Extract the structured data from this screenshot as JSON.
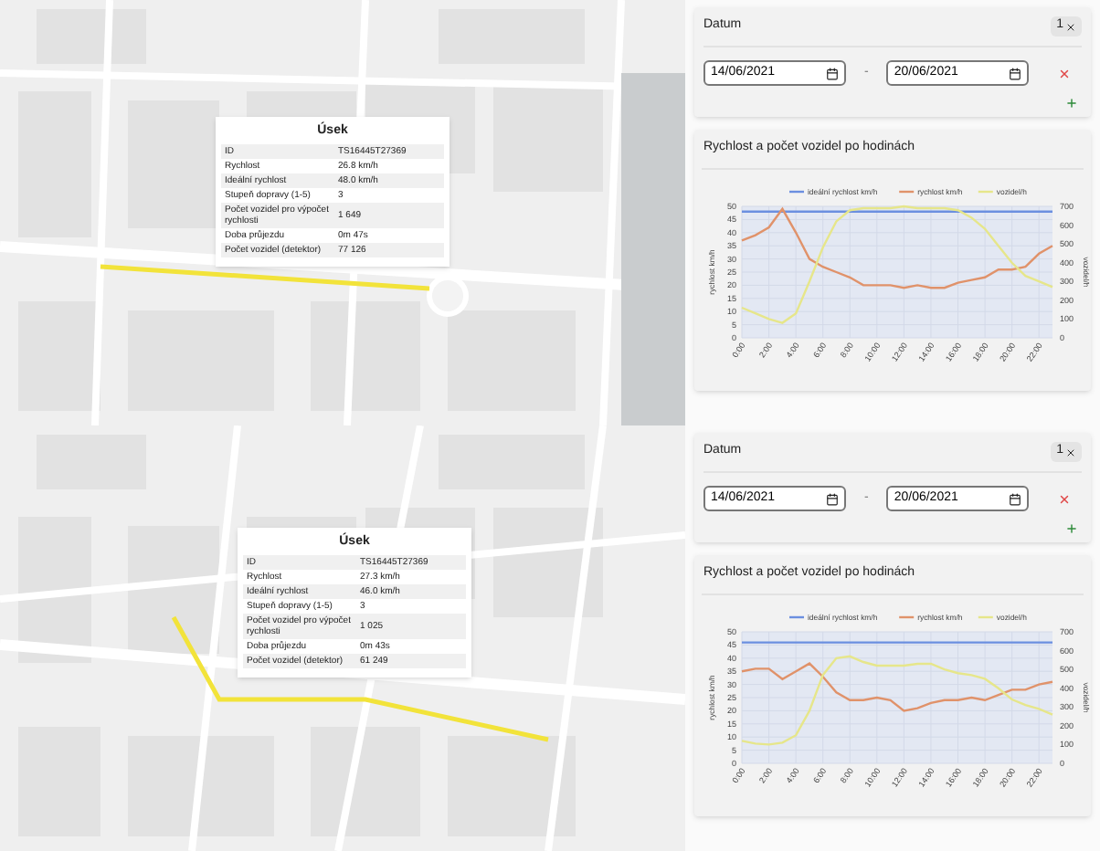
{
  "views": [
    {
      "popup": {
        "title": "Úsek",
        "rows": [
          {
            "label": "ID",
            "value": "TS16445T27369"
          },
          {
            "label": "Rychlost",
            "value": "26.8 km/h"
          },
          {
            "label": "Ideální rychlost",
            "value": "48.0 km/h"
          },
          {
            "label": "Stupeň dopravy (1-5)",
            "value": "3"
          },
          {
            "label": "Počet vozidel pro výpočet rychlosti",
            "value": "1 649"
          },
          {
            "label": "Doba průjezdu",
            "value": "0m 47s"
          },
          {
            "label": "Počet vozidel (detektor)",
            "value": "77 126"
          }
        ]
      },
      "filter": {
        "title": "Datum",
        "badge": "1",
        "from": "14/06/2021",
        "separator": "-",
        "to": "20/06/2021"
      },
      "chart": {
        "title": "Rychlost a počet vozidel po hodinách",
        "chart_data": {
          "type": "line",
          "grid": true,
          "legend": "top",
          "ylabel": "rychlost km/h",
          "y2label": "vozidel/h",
          "x": [
            0,
            1,
            2,
            3,
            4,
            5,
            6,
            7,
            8,
            9,
            10,
            11,
            12,
            13,
            14,
            15,
            16,
            17,
            18,
            19,
            20,
            21,
            22,
            23
          ],
          "xlim": [
            0,
            23
          ],
          "xticks": [
            {
              "value": 0,
              "label": "0:00"
            },
            {
              "value": 2,
              "label": "2:00"
            },
            {
              "value": 4,
              "label": "4:00"
            },
            {
              "value": 6,
              "label": "6:00"
            },
            {
              "value": 8,
              "label": "8:00"
            },
            {
              "value": 10,
              "label": "10:00"
            },
            {
              "value": 12,
              "label": "12:00"
            },
            {
              "value": 14,
              "label": "14:00"
            },
            {
              "value": 16,
              "label": "16:00"
            },
            {
              "value": 18,
              "label": "18:00"
            },
            {
              "value": 20,
              "label": "20:00"
            },
            {
              "value": 22,
              "label": "22:00"
            }
          ],
          "ylim": [
            0,
            50
          ],
          "yticks": [
            0,
            5,
            10,
            15,
            20,
            25,
            30,
            35,
            40,
            45,
            50
          ],
          "y2lim": [
            0,
            700
          ],
          "y2ticks": [
            0,
            100,
            200,
            300,
            400,
            500,
            600,
            700
          ],
          "series": [
            {
              "name": "ideální rychlost km/h",
              "color": "#6b8fe0",
              "values": [
                48,
                48,
                48,
                48,
                48,
                48,
                48,
                48,
                48,
                48,
                48,
                48,
                48,
                48,
                48,
                48,
                48,
                48,
                48,
                48,
                48,
                48,
                48,
                48
              ]
            },
            {
              "name": "rychlost km/h",
              "color": "#e0926a",
              "values": [
                37,
                39,
                42,
                49,
                40,
                30,
                27,
                25,
                23,
                20,
                20,
                20,
                19,
                20,
                19,
                19,
                21,
                22,
                23,
                26,
                26,
                27,
                32,
                35
              ]
            },
            {
              "name": "vozidel/h",
              "color": "#e6e68a",
              "axis": "y2",
              "values": [
                160,
                130,
                100,
                80,
                130,
                300,
                480,
                620,
                680,
                690,
                690,
                690,
                700,
                690,
                690,
                690,
                680,
                640,
                580,
                490,
                400,
                330,
                300,
                270
              ]
            }
          ]
        }
      }
    },
    {
      "popup": {
        "title": "Úsek",
        "rows": [
          {
            "label": "ID",
            "value": "TS16445T27369"
          },
          {
            "label": "Rychlost",
            "value": "27.3 km/h"
          },
          {
            "label": "Ideální rychlost",
            "value": "46.0 km/h"
          },
          {
            "label": "Stupeň dopravy (1-5)",
            "value": "3"
          },
          {
            "label": "Počet vozidel pro výpočet rychlosti",
            "value": "1 025"
          },
          {
            "label": "Doba průjezdu",
            "value": "0m 43s"
          },
          {
            "label": "Počet vozidel (detektor)",
            "value": "61 249"
          }
        ]
      },
      "filter": {
        "title": "Datum",
        "badge": "1",
        "from": "14/06/2021",
        "separator": "-",
        "to": "20/06/2021"
      },
      "chart": {
        "title": "Rychlost a počet vozidel po hodinách",
        "chart_data": {
          "type": "line",
          "grid": true,
          "legend": "top",
          "ylabel": "rychlost km/h",
          "y2label": "vozidel/h",
          "x": [
            0,
            1,
            2,
            3,
            4,
            5,
            6,
            7,
            8,
            9,
            10,
            11,
            12,
            13,
            14,
            15,
            16,
            17,
            18,
            19,
            20,
            21,
            22,
            23
          ],
          "xlim": [
            0,
            23
          ],
          "xticks": [
            {
              "value": 0,
              "label": "0:00"
            },
            {
              "value": 2,
              "label": "2:00"
            },
            {
              "value": 4,
              "label": "4:00"
            },
            {
              "value": 6,
              "label": "6:00"
            },
            {
              "value": 8,
              "label": "8:00"
            },
            {
              "value": 10,
              "label": "10:00"
            },
            {
              "value": 12,
              "label": "12:00"
            },
            {
              "value": 14,
              "label": "14:00"
            },
            {
              "value": 16,
              "label": "16:00"
            },
            {
              "value": 18,
              "label": "18:00"
            },
            {
              "value": 20,
              "label": "20:00"
            },
            {
              "value": 22,
              "label": "22:00"
            }
          ],
          "ylim": [
            0,
            50
          ],
          "yticks": [
            0,
            5,
            10,
            15,
            20,
            25,
            30,
            35,
            40,
            45,
            50
          ],
          "y2lim": [
            0,
            700
          ],
          "y2ticks": [
            0,
            100,
            200,
            300,
            400,
            500,
            600,
            700
          ],
          "series": [
            {
              "name": "ideální rychlost km/h",
              "color": "#6b8fe0",
              "values": [
                46,
                46,
                46,
                46,
                46,
                46,
                46,
                46,
                46,
                46,
                46,
                46,
                46,
                46,
                46,
                46,
                46,
                46,
                46,
                46,
                46,
                46,
                46,
                46
              ]
            },
            {
              "name": "rychlost km/h",
              "color": "#e0926a",
              "values": [
                35,
                36,
                36,
                32,
                35,
                38,
                33,
                27,
                24,
                24,
                25,
                24,
                20,
                21,
                23,
                24,
                24,
                25,
                24,
                26,
                28,
                28,
                30,
                31
              ]
            },
            {
              "name": "vozidel/h",
              "color": "#e6e68a",
              "axis": "y2",
              "values": [
                120,
                105,
                100,
                110,
                150,
                280,
                470,
                560,
                570,
                540,
                520,
                520,
                520,
                530,
                530,
                500,
                480,
                470,
                450,
                400,
                340,
                310,
                290,
                260
              ]
            }
          ]
        }
      }
    }
  ]
}
